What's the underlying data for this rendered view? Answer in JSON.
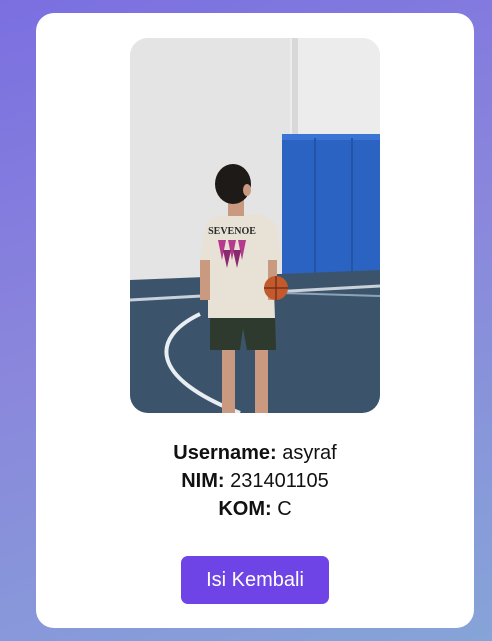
{
  "profile": {
    "photo_alt": "Profile photo",
    "username_label": "Username:",
    "username_value": "asyraf",
    "nim_label": "NIM:",
    "nim_value": "231401105",
    "kom_label": "KOM:",
    "kom_value": "C"
  },
  "actions": {
    "refill_label": "Isi Kembali"
  },
  "colors": {
    "accent": "#6e44e6"
  }
}
